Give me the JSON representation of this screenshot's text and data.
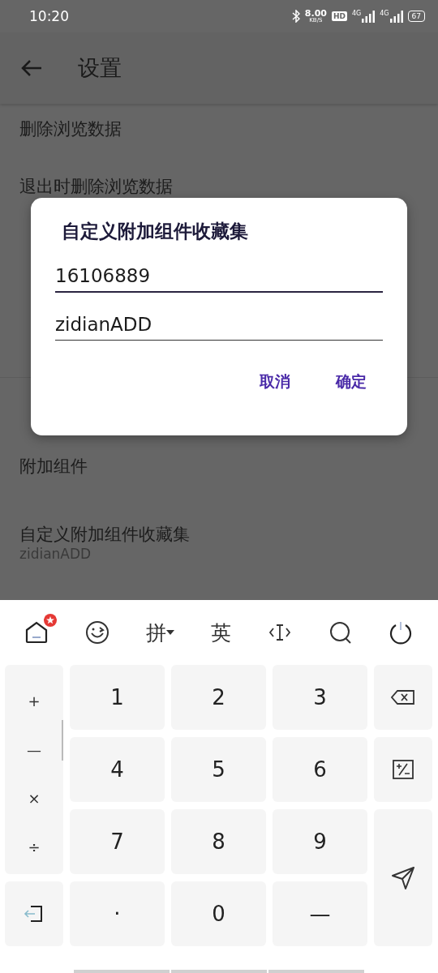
{
  "status_bar": {
    "time": "10:20",
    "net_speed": "8.00",
    "net_speed_unit": "KB/S",
    "hd": "HD",
    "signals": [
      {
        "label": "4G"
      },
      {
        "label": "4G"
      }
    ],
    "battery": "67"
  },
  "app_bar": {
    "title": "设置"
  },
  "settings": [
    {
      "kind": "item",
      "title": "删除浏览数据"
    },
    {
      "kind": "item",
      "title": "退出时删除浏览数据"
    },
    {
      "kind": "covered"
    },
    {
      "kind": "covered"
    },
    {
      "kind": "covered"
    },
    {
      "kind": "section_break"
    },
    {
      "kind": "item",
      "title": "附加组件"
    },
    {
      "kind": "item",
      "title": "自定义附加组件收藏集",
      "summary": "zidianADD"
    }
  ],
  "dialog": {
    "title": "自定义附加组件收藏集",
    "fields": [
      {
        "value": "16106889",
        "focused": true
      },
      {
        "value": "zidianADD",
        "focused": false
      }
    ],
    "buttons": [
      "取消",
      "确定"
    ]
  },
  "keyboard": {
    "toolbar": [
      {
        "kind": "home",
        "badge": true
      },
      {
        "kind": "emoji"
      },
      {
        "kind": "text",
        "label": "拼",
        "dropdown": true
      },
      {
        "kind": "text",
        "label": "英",
        "dropdown": false
      },
      {
        "kind": "cursor"
      },
      {
        "kind": "search"
      },
      {
        "kind": "power"
      }
    ],
    "symbols": [
      "+",
      "—",
      "×",
      "÷"
    ],
    "keys": [
      "1",
      "2",
      "3",
      "4",
      "5",
      "6",
      "7",
      "8",
      "9",
      "·",
      "0",
      "—"
    ]
  }
}
